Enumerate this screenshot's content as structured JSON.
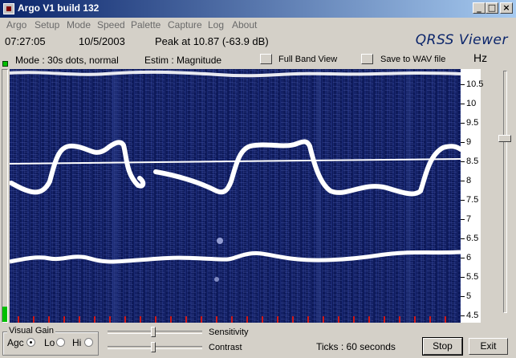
{
  "window": {
    "title": "Argo V1 build 132"
  },
  "menu": [
    "Argo",
    "Setup",
    "Mode",
    "Speed",
    "Palette",
    "Capture",
    "Log",
    "About"
  ],
  "status": {
    "time": "07:27:05",
    "date": "10/5/2003",
    "peak": "Peak at  10.87 (-63.9 dB)",
    "brand": "QRSS Viewer"
  },
  "mode": {
    "mode_text": "Mode : 30s dots, normal",
    "estim_text": "Estim : Magnitude",
    "full_band_label": "Full Band View",
    "save_wav_label": "Save to WAV file"
  },
  "scale": {
    "unit": "Hz",
    "labels": [
      "10.5",
      "10",
      "9.5",
      "9",
      "8.5",
      "8",
      "7.5",
      "7",
      "6.5",
      "6",
      "5.5",
      "5",
      "4.5"
    ]
  },
  "controls": {
    "visual_gain_title": "Visual Gain",
    "agc_label": "Agc",
    "lo_label": "Lo",
    "hi_label": "Hi",
    "selected_gain": "Agc",
    "sensitivity_label": "Sensitivity",
    "contrast_label": "Contrast",
    "sensitivity_level": 0.48,
    "contrast_level": 0.48,
    "ticks_label": "Ticks   : 60 seconds",
    "stop_label": "Stop",
    "exit_label": "Exit"
  },
  "colors": {
    "titlebar": "#0a246a",
    "spectrum_bg": "#0e1a5a",
    "trace": "#ffffff",
    "tick_marks": "#d01818",
    "led": "#00c000"
  }
}
